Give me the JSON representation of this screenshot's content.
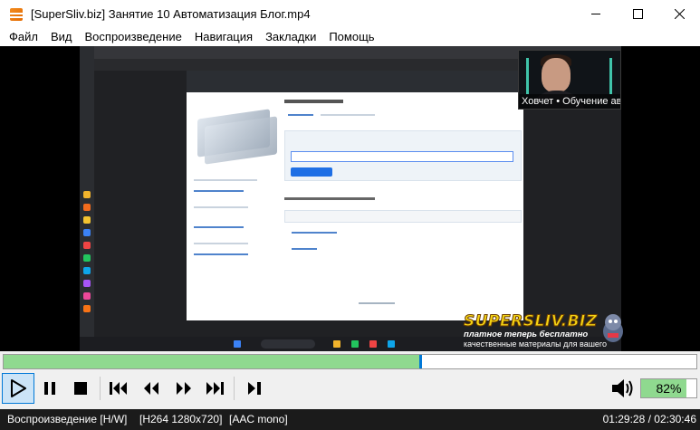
{
  "window": {
    "title": "[SuperSliv.biz] Занятие 10 Автоматизация Блог.mp4",
    "icon": "vlc-cone-icon",
    "controls": [
      "minimize-icon",
      "maximize-icon",
      "close-icon"
    ]
  },
  "menu": {
    "items": [
      "Файл",
      "Вид",
      "Воспроизведение",
      "Навигация",
      "Закладки",
      "Помощь"
    ]
  },
  "video": {
    "webcam_caption": "Ховчет • Обучение ав...",
    "watermark": {
      "main": "SUPERSLIV.BIZ",
      "sub": "платное теперь бесплатно",
      "sub2": "качественные материалы для вашего развития"
    }
  },
  "seek": {
    "progress": 0.6
  },
  "controls": {
    "buttons": [
      "play-icon",
      "pause-icon",
      "stop-icon",
      "previous-icon",
      "rewind-icon",
      "fast-forward-icon",
      "next-icon",
      "frame-step-icon"
    ]
  },
  "volume": {
    "level_text": "82%",
    "level": 0.82
  },
  "status": {
    "state": "Воспроизведение [H/W]",
    "video_codec": "[H264 1280x720]",
    "audio_codec": "[AAC mono]",
    "time": "01:29:28 / 02:30:46"
  },
  "colors": {
    "progress_fill": "#8fd98f",
    "seek_thumb": "#0078d7",
    "status_bg": "#1b1b1b"
  }
}
